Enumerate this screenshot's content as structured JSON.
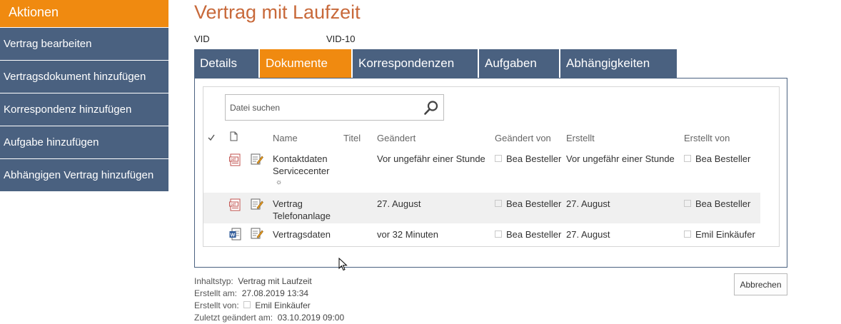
{
  "sidebar": {
    "header": "Aktionen",
    "items": [
      {
        "label": "Vertrag bearbeiten"
      },
      {
        "label": "Vertragsdokument hinzufügen"
      },
      {
        "label": "Korrespondenz hinzufügen"
      },
      {
        "label": "Aufgabe hinzufügen"
      },
      {
        "label": "Abhängigen Vertrag hinzufügen"
      }
    ]
  },
  "page": {
    "title": "Vertrag mit Laufzeit",
    "vid_label": "VID",
    "vid_value": "VID-10"
  },
  "tabs": [
    {
      "label": "Details"
    },
    {
      "label": "Dokumente",
      "active": true
    },
    {
      "label": "Korrespondenzen"
    },
    {
      "label": "Aufgaben"
    },
    {
      "label": "Abhängigkeiten"
    }
  ],
  "search": {
    "placeholder": "Datei suchen"
  },
  "table": {
    "columns": {
      "name": "Name",
      "titel": "Titel",
      "geaendert": "Geändert",
      "geaendert_von": "Geändert von",
      "erstellt": "Erstellt",
      "erstellt_von": "Erstellt von"
    },
    "rows": [
      {
        "icon": "pdf-file-icon",
        "name_line1": "Kontaktdaten",
        "name_line2": "Servicecenter",
        "new_marker": "☼",
        "geaendert": "Vor ungefähr einer Stunde",
        "geaendert_von": "Bea Besteller",
        "erstellt": "Vor ungefähr einer Stunde",
        "erstellt_von": "Bea Besteller"
      },
      {
        "icon": "pdf-file-icon",
        "name_line1": "Vertrag",
        "name_line2": "Telefonanlage",
        "geaendert": "27. August",
        "geaendert_von": "Bea Besteller",
        "erstellt": "27. August",
        "erstellt_von": "Bea Besteller"
      },
      {
        "icon": "word-file-icon",
        "name_line1": "Vertragsdaten",
        "geaendert": "vor 32 Minuten",
        "geaendert_von": "Bea Besteller",
        "erstellt": "27. August",
        "erstellt_von": "Emil Einkäufer"
      }
    ]
  },
  "footer": {
    "inhaltstyp_label": "Inhaltstyp:",
    "inhaltstyp_value": "Vertrag mit Laufzeit",
    "erstellt_am_label": "Erstellt am:",
    "erstellt_am_value": "27.08.2019 13:34",
    "erstellt_von_label": "Erstellt von:",
    "erstellt_von_value": "Emil Einkäufer",
    "zuletzt_label": "Zuletzt geändert am:",
    "zuletzt_value": "03.10.2019 09:00"
  },
  "buttons": {
    "cancel": "Abbrechen"
  },
  "colors": {
    "accent": "#f08a10",
    "nav": "#4a6180",
    "title": "#c8693a"
  }
}
